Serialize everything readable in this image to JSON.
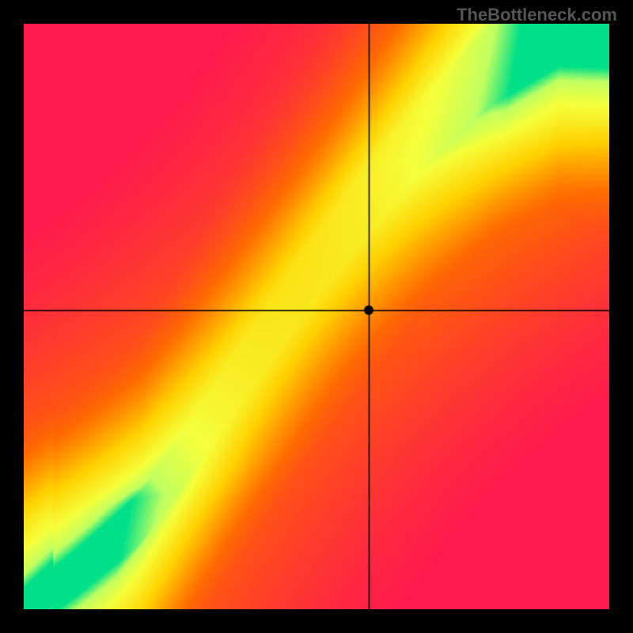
{
  "watermark": "TheBottleneck.com",
  "chart_data": {
    "type": "heatmap",
    "title": "",
    "xlabel": "",
    "ylabel": "",
    "xlim": [
      0,
      100
    ],
    "ylim": [
      0,
      100
    ],
    "crosshair": {
      "x": 59,
      "y": 51
    },
    "marker": {
      "x": 59,
      "y": 51
    },
    "colorscale": {
      "0.0": "#ff1a4d",
      "0.35": "#ff6a00",
      "0.6": "#ffd000",
      "0.8": "#f5ff3a",
      "0.95": "#00e089",
      "1.0": "#00e089"
    },
    "ideal_curve_description": "Optimal balance curve rises from lower-left to upper-right with an S-shape; green band indicates balanced pairing, warm colors indicate bottleneck.",
    "ideal_curve_samples": [
      {
        "x": 0,
        "y": 0
      },
      {
        "x": 10,
        "y": 8
      },
      {
        "x": 20,
        "y": 17
      },
      {
        "x": 30,
        "y": 28
      },
      {
        "x": 40,
        "y": 42
      },
      {
        "x": 50,
        "y": 58
      },
      {
        "x": 55,
        "y": 66
      },
      {
        "x": 60,
        "y": 75
      },
      {
        "x": 70,
        "y": 88
      },
      {
        "x": 80,
        "y": 96
      },
      {
        "x": 90,
        "y": 99
      },
      {
        "x": 100,
        "y": 100
      }
    ]
  }
}
